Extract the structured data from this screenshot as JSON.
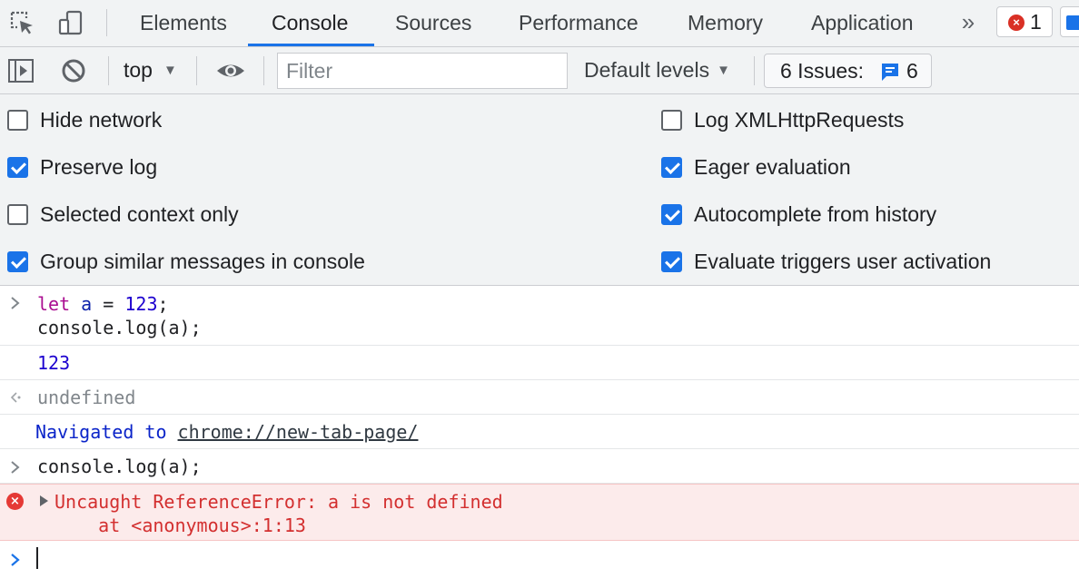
{
  "tabs": {
    "items": [
      "Elements",
      "Console",
      "Sources",
      "Performance",
      "Memory",
      "Application"
    ],
    "active": "Console",
    "more_icon": "chevron-double-right-icon",
    "error_count": "1"
  },
  "toolbar": {
    "context": "top",
    "filter_placeholder": "Filter",
    "levels": "Default levels",
    "issues_label": "6 Issues:",
    "issues_count": "6"
  },
  "settings": {
    "left": [
      {
        "label": "Hide network",
        "checked": false
      },
      {
        "label": "Preserve log",
        "checked": true
      },
      {
        "label": "Selected context only",
        "checked": false
      },
      {
        "label": "Group similar messages in console",
        "checked": true
      }
    ],
    "right": [
      {
        "label": "Log XMLHttpRequests",
        "checked": false
      },
      {
        "label": "Eager evaluation",
        "checked": true
      },
      {
        "label": "Autocomplete from history",
        "checked": true
      },
      {
        "label": "Evaluate triggers user activation",
        "checked": true
      }
    ]
  },
  "console": {
    "input1": {
      "kw": "let",
      "var": "a",
      "op": "=",
      "num": "123",
      "semi": ";",
      "line2": "console.log(a);"
    },
    "output_value": "123",
    "return_value": "undefined",
    "navigated_prefix": "Navigated to",
    "navigated_url": "chrome://new-tab-page/",
    "input2": "console.log(a);",
    "error_line1": "Uncaught ReferenceError: a is not defined",
    "error_line2": "    at <anonymous>:1:13"
  },
  "colors": {
    "accent": "#1a73e8",
    "error": "#d93025",
    "error_bg": "#fcebeb"
  }
}
